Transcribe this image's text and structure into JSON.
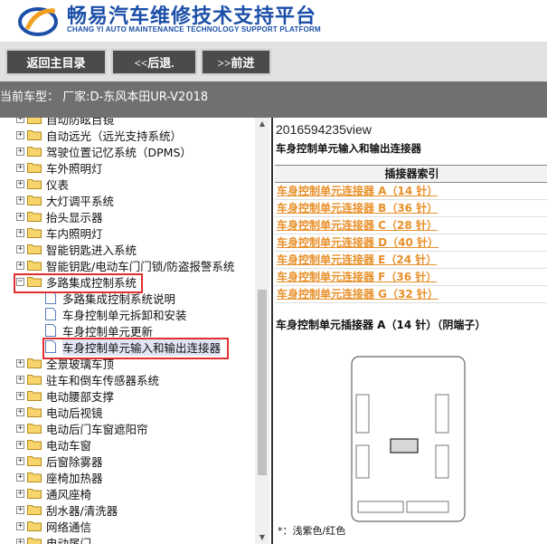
{
  "header": {
    "title": "畅易汽车维修技术支持平台",
    "subtitle": "CHANG YI AUTO MAINTENANCE TECHNOLOGY SUPPORT PLATFORM",
    "logo_icon": "brand-logo-icon"
  },
  "nav": {
    "home_label": "返回主目录",
    "back_label": "<<后退.",
    "forward_label": ">>前进"
  },
  "car_bar": {
    "text": "当前车型： 厂家:D-东风本田UR-V2018"
  },
  "tree": {
    "top_cut": "自动防眩目镜",
    "items": [
      {
        "label": "自动远光（远光支持系统）",
        "type": "folder"
      },
      {
        "label": "驾驶位置记忆系统（DPMS）",
        "type": "folder"
      },
      {
        "label": "车外照明灯",
        "type": "folder"
      },
      {
        "label": "仪表",
        "type": "folder"
      },
      {
        "label": "大灯调平系统",
        "type": "folder"
      },
      {
        "label": "抬头显示器",
        "type": "folder"
      },
      {
        "label": "车内照明灯",
        "type": "folder"
      },
      {
        "label": "智能钥匙进入系统",
        "type": "folder"
      },
      {
        "label": "智能钥匙/电动车门门锁/防盗报警系统",
        "type": "folder"
      },
      {
        "label": "多路集成控制系统",
        "type": "folder-open"
      },
      {
        "label": "多路集成控制系统说明",
        "type": "doc"
      },
      {
        "label": "车身控制单元拆卸和安装",
        "type": "doc"
      },
      {
        "label": "车身控制单元更新",
        "type": "doc"
      },
      {
        "label": "车身控制单元输入和输出连接器",
        "type": "doc-selected"
      },
      {
        "label": "全景玻璃车顶",
        "type": "folder"
      },
      {
        "label": "驻车和倒车传感器系统",
        "type": "folder"
      },
      {
        "label": "电动腰部支撑",
        "type": "folder"
      },
      {
        "label": "电动后视镜",
        "type": "folder"
      },
      {
        "label": "电动后门车窗遮阳帘",
        "type": "folder"
      },
      {
        "label": "电动车窗",
        "type": "folder"
      },
      {
        "label": "后窗除雾器",
        "type": "folder"
      },
      {
        "label": "座椅加热器",
        "type": "folder"
      },
      {
        "label": "通风座椅",
        "type": "folder"
      },
      {
        "label": "刮水器/清洗器",
        "type": "folder"
      },
      {
        "label": "网络通信",
        "type": "folder"
      },
      {
        "label": "电动尾门",
        "type": "folder"
      }
    ]
  },
  "content": {
    "view_id": "2016594235view",
    "title": "车身控制单元输入和输出连接器",
    "index_header": "插接器索引",
    "links": [
      "车身控制单元连接器 A（14 针）",
      "车身控制单元连接器 B（36 针）",
      "车身控制单元连接器 C（28 针）",
      "车身控制单元连接器 D（40 针）",
      "车身控制单元连接器 E（24 针）",
      "车身控制单元连接器 F（36 针）",
      "车身控制单元连接器 G（32 针）"
    ],
    "connector_title": "车身控制单元插接器 A（14 针）（阴端子）",
    "footnote": "*：浅紫色/红色"
  },
  "colors": {
    "link": "#e8902a",
    "highlight_box": "#e23030",
    "brand_blue": "#1b4fa8"
  }
}
